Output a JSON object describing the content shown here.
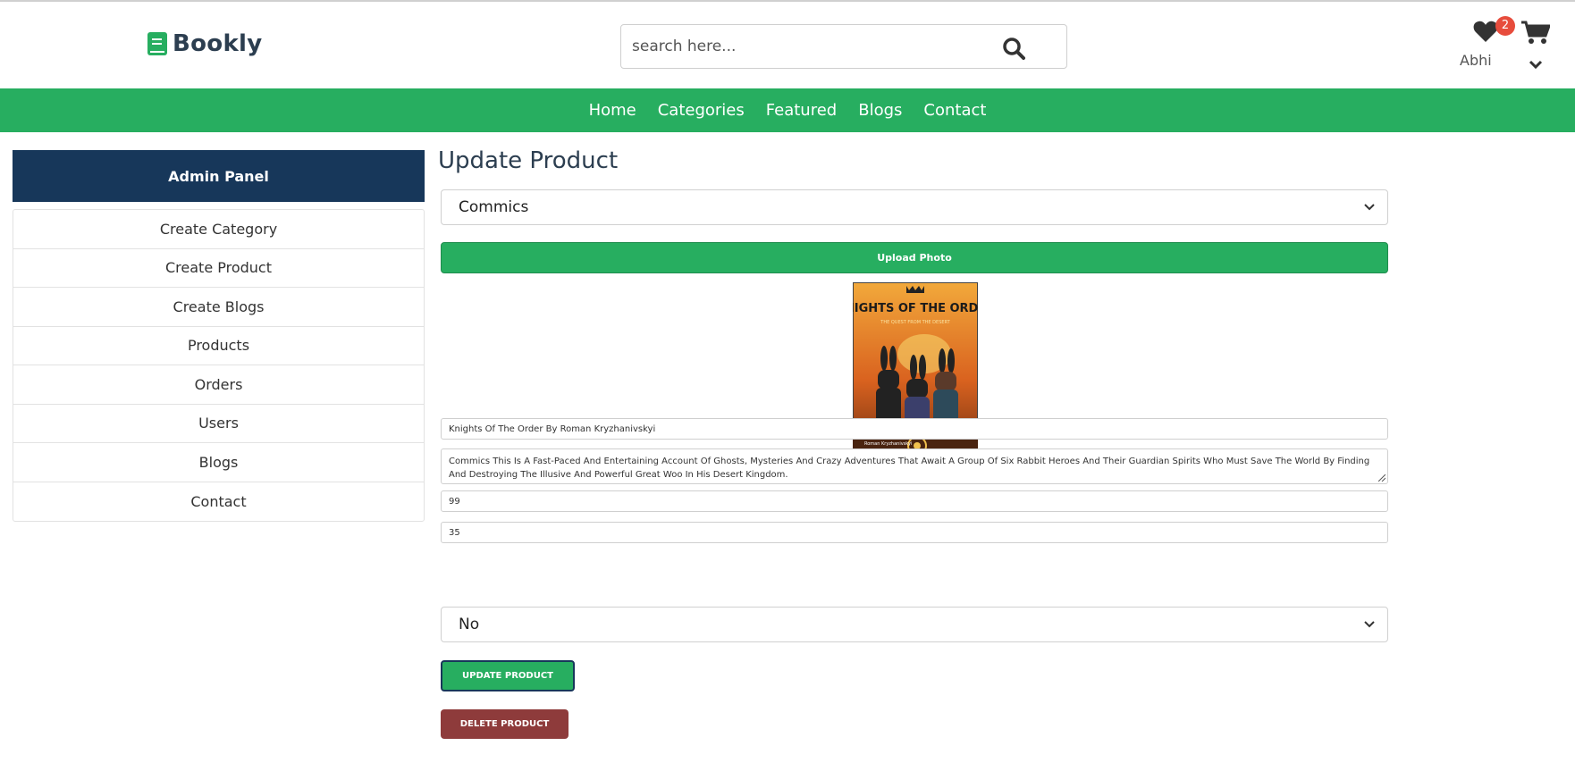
{
  "brand": {
    "name": "Bookly"
  },
  "search": {
    "placeholder": "search here..."
  },
  "user": {
    "name": "Abhi",
    "wishlist_count": "2"
  },
  "nav": {
    "items": [
      "Home",
      "Categories",
      "Featured",
      "Blogs",
      "Contact"
    ]
  },
  "sidebar": {
    "title": "Admin Panel",
    "items": [
      "Create Category",
      "Create Product",
      "Create Blogs",
      "Products",
      "Orders",
      "Users",
      "Blogs",
      "Contact"
    ]
  },
  "form": {
    "title": "Update Product",
    "category": "Commics",
    "upload_label": "Upload Photo",
    "cover": {
      "title": "KNIGHTS OF THE ORDER",
      "subtitle": "THE QUEST FROM THE DESERT",
      "author": "Roman Kryzhanivskyi"
    },
    "name": "Knights Of The Order By Roman Kryzhanivskyi",
    "description": "Commics This Is A Fast-Paced And Entertaining Account Of Ghosts, Mysteries And Crazy Adventures That Await A Group Of Six Rabbit Heroes And Their Guardian Spirits Who Must Save The World By Finding And Destroying The Illusive And Powerful Great Woo In His Desert Kingdom.",
    "price": "99",
    "quantity": "35",
    "shipping": "No",
    "update_label": "UPDATE PRODUCT",
    "delete_label": "DELETE PRODUCT"
  },
  "colors": {
    "brand_green": "#27ae60",
    "navy": "#17375a",
    "danger": "#8e3b3b",
    "badge": "#e74c3c"
  },
  "icons": {
    "logo": "book-icon",
    "search": "search-icon",
    "wishlist": "heart-icon",
    "cart": "cart-icon",
    "menu": "chevron-down-icon"
  }
}
